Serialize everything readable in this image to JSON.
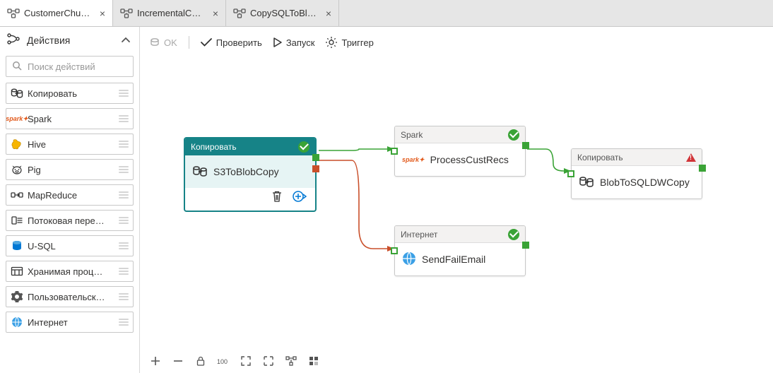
{
  "tabs": [
    {
      "label": "CustomerChur…",
      "active": true
    },
    {
      "label": "IncrementalCo…",
      "active": false
    },
    {
      "label": "CopySQLToBlo…",
      "active": false
    }
  ],
  "sidebar": {
    "title": "Действия",
    "search_placeholder": "Поиск действий",
    "items": [
      {
        "label": "Копировать",
        "icon": "copy"
      },
      {
        "label": "Spark",
        "icon": "spark"
      },
      {
        "label": "Hive",
        "icon": "hive"
      },
      {
        "label": "Pig",
        "icon": "pig"
      },
      {
        "label": "MapReduce",
        "icon": "mapreduce"
      },
      {
        "label": "Потоковая пере…",
        "icon": "stream"
      },
      {
        "label": "U-SQL",
        "icon": "usql"
      },
      {
        "label": "Хранимая проц…",
        "icon": "sproc"
      },
      {
        "label": "Пользовательск…",
        "icon": "custom"
      },
      {
        "label": "Интернет",
        "icon": "web"
      }
    ]
  },
  "toolbar": {
    "ok": "OK",
    "validate": "Проверить",
    "run": "Запуск",
    "trigger": "Триггер"
  },
  "nodes": {
    "s3copy": {
      "type": "Копировать",
      "name": "S3ToBlobCopy",
      "status": "ok",
      "selected": true
    },
    "spark": {
      "type": "Spark",
      "name": "ProcessCustRecs",
      "status": "ok"
    },
    "web": {
      "type": "Интернет",
      "name": "SendFailEmail",
      "status": "ok"
    },
    "blobcopy": {
      "type": "Копировать",
      "name": "BlobToSQLDWCopy",
      "status": "warn"
    }
  }
}
